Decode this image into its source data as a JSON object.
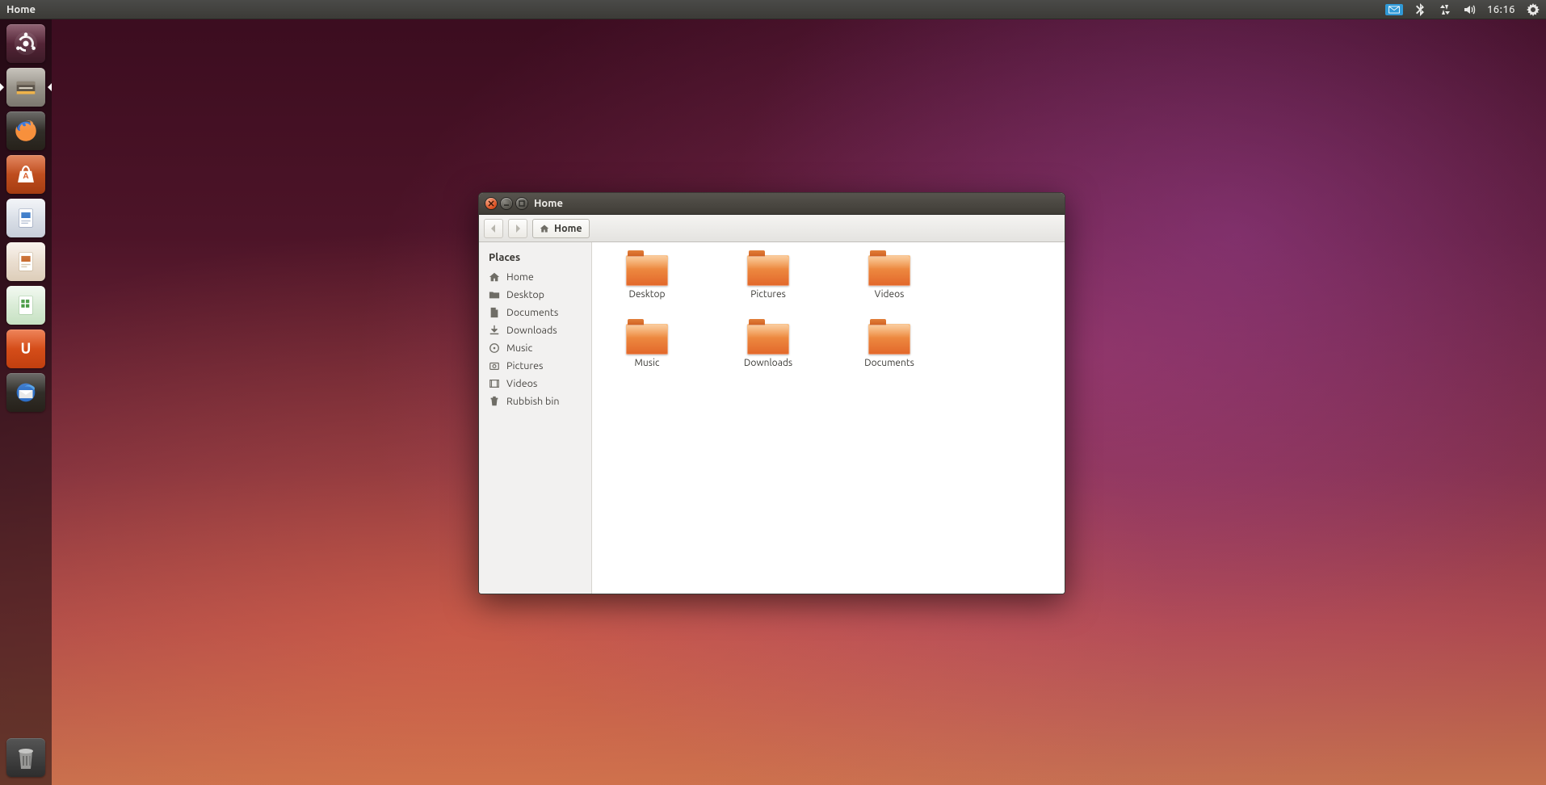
{
  "panel": {
    "title": "Home",
    "clock": "16:16"
  },
  "launcher": {
    "items": [
      {
        "id": "dash",
        "name": "Dash Home"
      },
      {
        "id": "files",
        "name": "Files",
        "pip_left": true,
        "pip_right": true
      },
      {
        "id": "firefox",
        "name": "Firefox"
      },
      {
        "id": "software",
        "name": "Software Centre"
      },
      {
        "id": "writer",
        "name": "LibreOffice Writer"
      },
      {
        "id": "impress",
        "name": "LibreOffice Impress"
      },
      {
        "id": "calc",
        "name": "LibreOffice Calc"
      },
      {
        "id": "ubuntuone",
        "name": "Ubuntu One"
      },
      {
        "id": "thunderbird",
        "name": "Thunderbird"
      }
    ],
    "trash": "Rubbish bin"
  },
  "window": {
    "title": "Home",
    "breadcrumb": "Home",
    "sidebar_label": "Places",
    "places": [
      {
        "icon": "home",
        "label": "Home"
      },
      {
        "icon": "desktop",
        "label": "Desktop"
      },
      {
        "icon": "document",
        "label": "Documents"
      },
      {
        "icon": "download",
        "label": "Downloads"
      },
      {
        "icon": "music",
        "label": "Music"
      },
      {
        "icon": "pictures",
        "label": "Pictures"
      },
      {
        "icon": "videos",
        "label": "Videos"
      },
      {
        "icon": "trash",
        "label": "Rubbish bin"
      }
    ],
    "folders": [
      {
        "label": "Desktop"
      },
      {
        "label": "Pictures"
      },
      {
        "label": "Videos"
      },
      {
        "label": "Music"
      },
      {
        "label": "Downloads"
      },
      {
        "label": "Documents"
      }
    ]
  }
}
